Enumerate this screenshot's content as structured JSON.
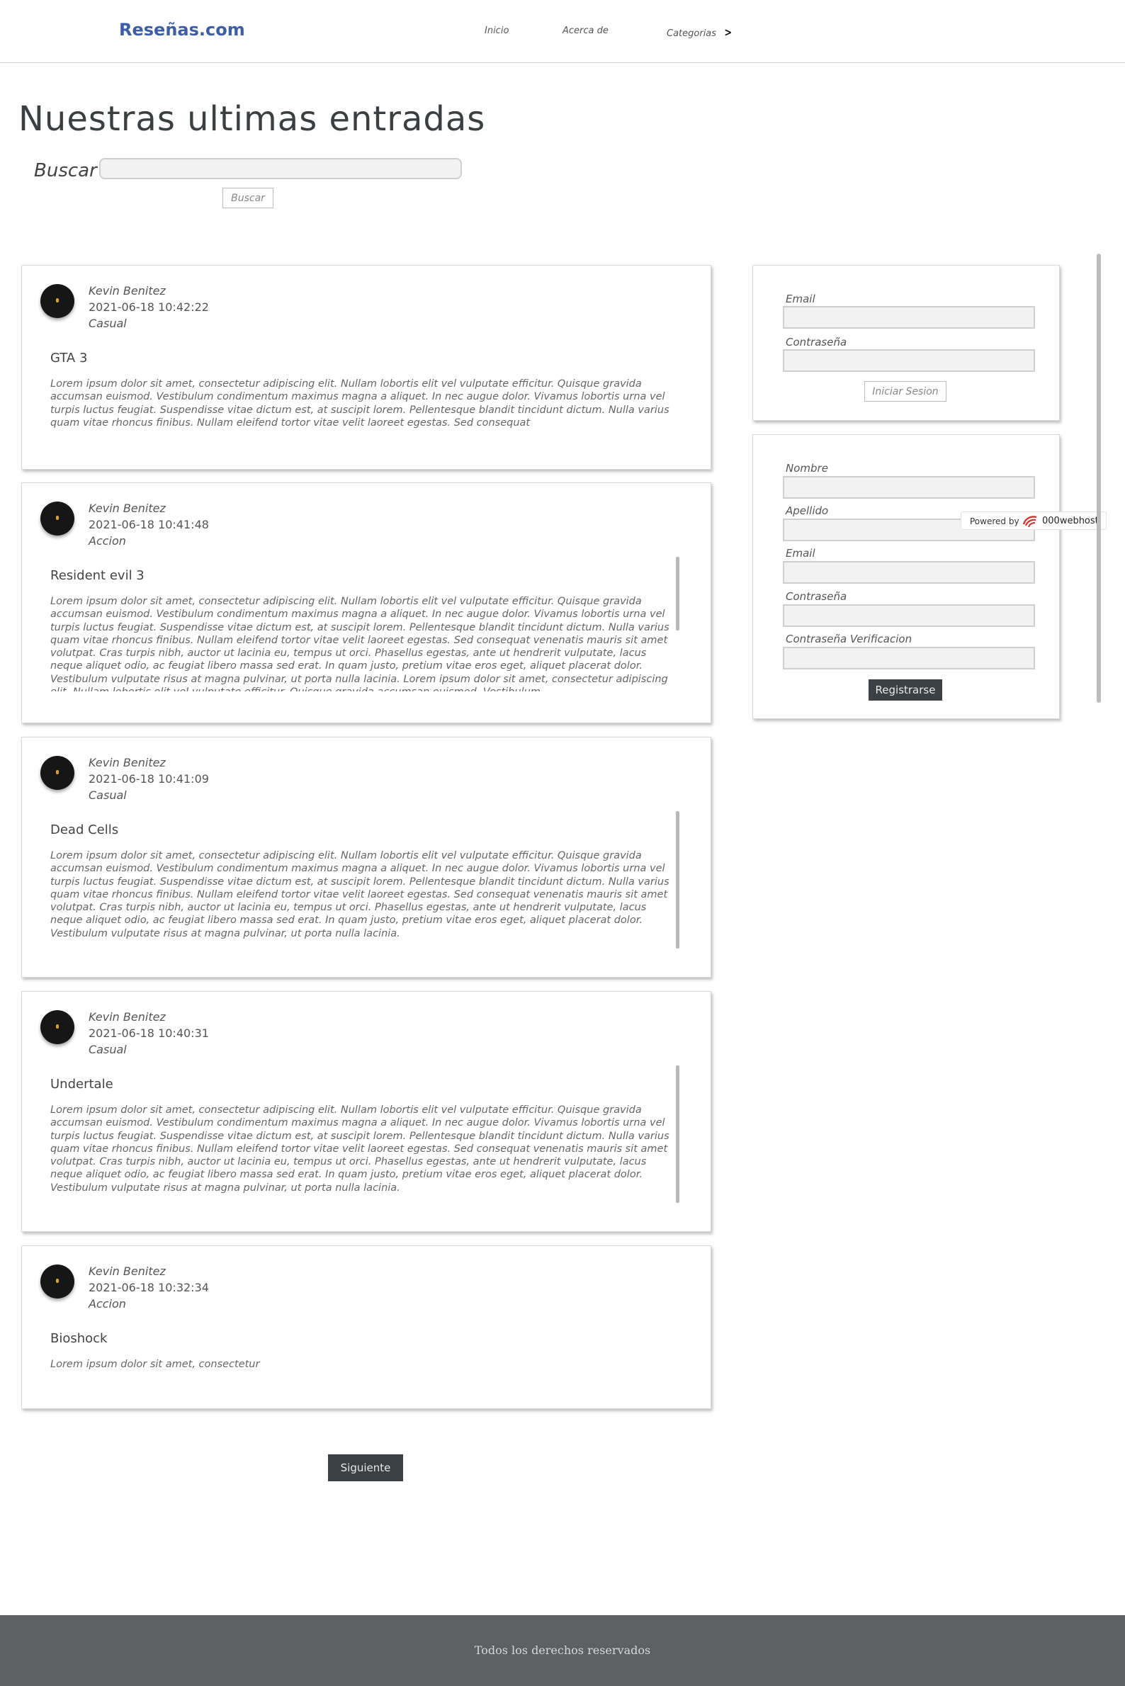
{
  "nav": {
    "brand": "Reseñas.com",
    "links": [
      "Inicio",
      "Acerca de",
      "Categorias"
    ]
  },
  "page": {
    "title": "Nuestras ultimas entradas",
    "search_label": "Buscar",
    "search_value": "",
    "search_button": "Buscar"
  },
  "posts": [
    {
      "author": "Kevin Benitez",
      "date": "2021-06-18 10:42:22",
      "category": "Casual",
      "title": "GTA 3",
      "body": "Lorem ipsum dolor sit amet, consectetur adipiscing elit. Nullam lobortis elit vel vulputate efficitur. Quisque gravida accumsan euismod. Vestibulum condimentum maximus magna a aliquet. In nec augue dolor. Vivamus lobortis urna vel turpis luctus feugiat. Suspendisse vitae dictum est, at suscipit lorem. Pellentesque blandit tincidunt dictum. Nulla varius quam vitae rhoncus finibus. Nullam eleifend tortor vitae velit laoreet egestas. Sed consequat"
    },
    {
      "author": "Kevin Benitez",
      "date": "2021-06-18 10:41:48",
      "category": "Accion",
      "title": "Resident evil 3",
      "body": "Lorem ipsum dolor sit amet, consectetur adipiscing elit. Nullam lobortis elit vel vulputate efficitur. Quisque gravida accumsan euismod. Vestibulum condimentum maximus magna a aliquet. In nec augue dolor. Vivamus lobortis urna vel turpis luctus feugiat. Suspendisse vitae dictum est, at suscipit lorem. Pellentesque blandit tincidunt dictum. Nulla varius quam vitae rhoncus finibus. Nullam eleifend tortor vitae velit laoreet egestas. Sed consequat venenatis mauris sit amet volutpat. Cras turpis nibh, auctor ut lacinia eu, tempus ut orci. Phasellus egestas, ante ut hendrerit vulputate, lacus neque aliquet odio, ac feugiat libero massa sed erat. In quam justo, pretium vitae eros eget, aliquet placerat dolor. Vestibulum vulputate risus at magna pulvinar, ut porta nulla lacinia. Lorem ipsum dolor sit amet, consectetur adipiscing elit. Nullam lobortis elit vel vulputate efficitur. Quisque gravida accumsan euismod. Vestibulum"
    },
    {
      "author": "Kevin Benitez",
      "date": "2021-06-18 10:41:09",
      "category": "Casual",
      "title": "Dead Cells",
      "body": "Lorem ipsum dolor sit amet, consectetur adipiscing elit. Nullam lobortis elit vel vulputate efficitur. Quisque gravida accumsan euismod. Vestibulum condimentum maximus magna a aliquet. In nec augue dolor. Vivamus lobortis urna vel turpis luctus feugiat. Suspendisse vitae dictum est, at suscipit lorem. Pellentesque blandit tincidunt dictum. Nulla varius quam vitae rhoncus finibus. Nullam eleifend tortor vitae velit laoreet egestas. Sed consequat venenatis mauris sit amet volutpat. Cras turpis nibh, auctor ut lacinia eu, tempus ut orci. Phasellus egestas, ante ut hendrerit vulputate, lacus neque aliquet odio, ac feugiat libero massa sed erat. In quam justo, pretium vitae eros eget, aliquet placerat dolor. Vestibulum vulputate risus at magna pulvinar, ut porta nulla lacinia."
    },
    {
      "author": "Kevin Benitez",
      "date": "2021-06-18 10:40:31",
      "category": "Casual",
      "title": "Undertale",
      "body": "Lorem ipsum dolor sit amet, consectetur adipiscing elit. Nullam lobortis elit vel vulputate efficitur. Quisque gravida accumsan euismod. Vestibulum condimentum maximus magna a aliquet. In nec augue dolor. Vivamus lobortis urna vel turpis luctus feugiat. Suspendisse vitae dictum est, at suscipit lorem. Pellentesque blandit tincidunt dictum. Nulla varius quam vitae rhoncus finibus. Nullam eleifend tortor vitae velit laoreet egestas. Sed consequat venenatis mauris sit amet volutpat. Cras turpis nibh, auctor ut lacinia eu, tempus ut orci. Phasellus egestas, ante ut hendrerit vulputate, lacus neque aliquet odio, ac feugiat libero massa sed erat. In quam justo, pretium vitae eros eget, aliquet placerat dolor. Vestibulum vulputate risus at magna pulvinar, ut porta nulla lacinia."
    },
    {
      "author": "Kevin Benitez",
      "date": "2021-06-18 10:32:34",
      "category": "Accion",
      "title": "Bioshock",
      "body": "Lorem ipsum dolor sit amet, consectetur"
    }
  ],
  "pagination": {
    "next_label": "Siguiente"
  },
  "login": {
    "email_label": "Email",
    "password_label": "Contraseña",
    "submit_label": "Iniciar Sesion"
  },
  "register": {
    "name_label": "Nombre",
    "lastname_label": "Apellido",
    "email_label": "Email",
    "password_label": "Contraseña",
    "password_verify_label": "Contraseña Verificacion",
    "submit_label": "Registrarse"
  },
  "badge": {
    "powered_by": "Powered by",
    "brand": "000webhost",
    "logo_icon": "000webhost-logo-icon"
  },
  "footer": {
    "text": "Todos los derechos reservados"
  },
  "colors": {
    "brand": "#3b5ea8",
    "dark_button": "#3a4043",
    "footer_bg": "#5c6063"
  }
}
